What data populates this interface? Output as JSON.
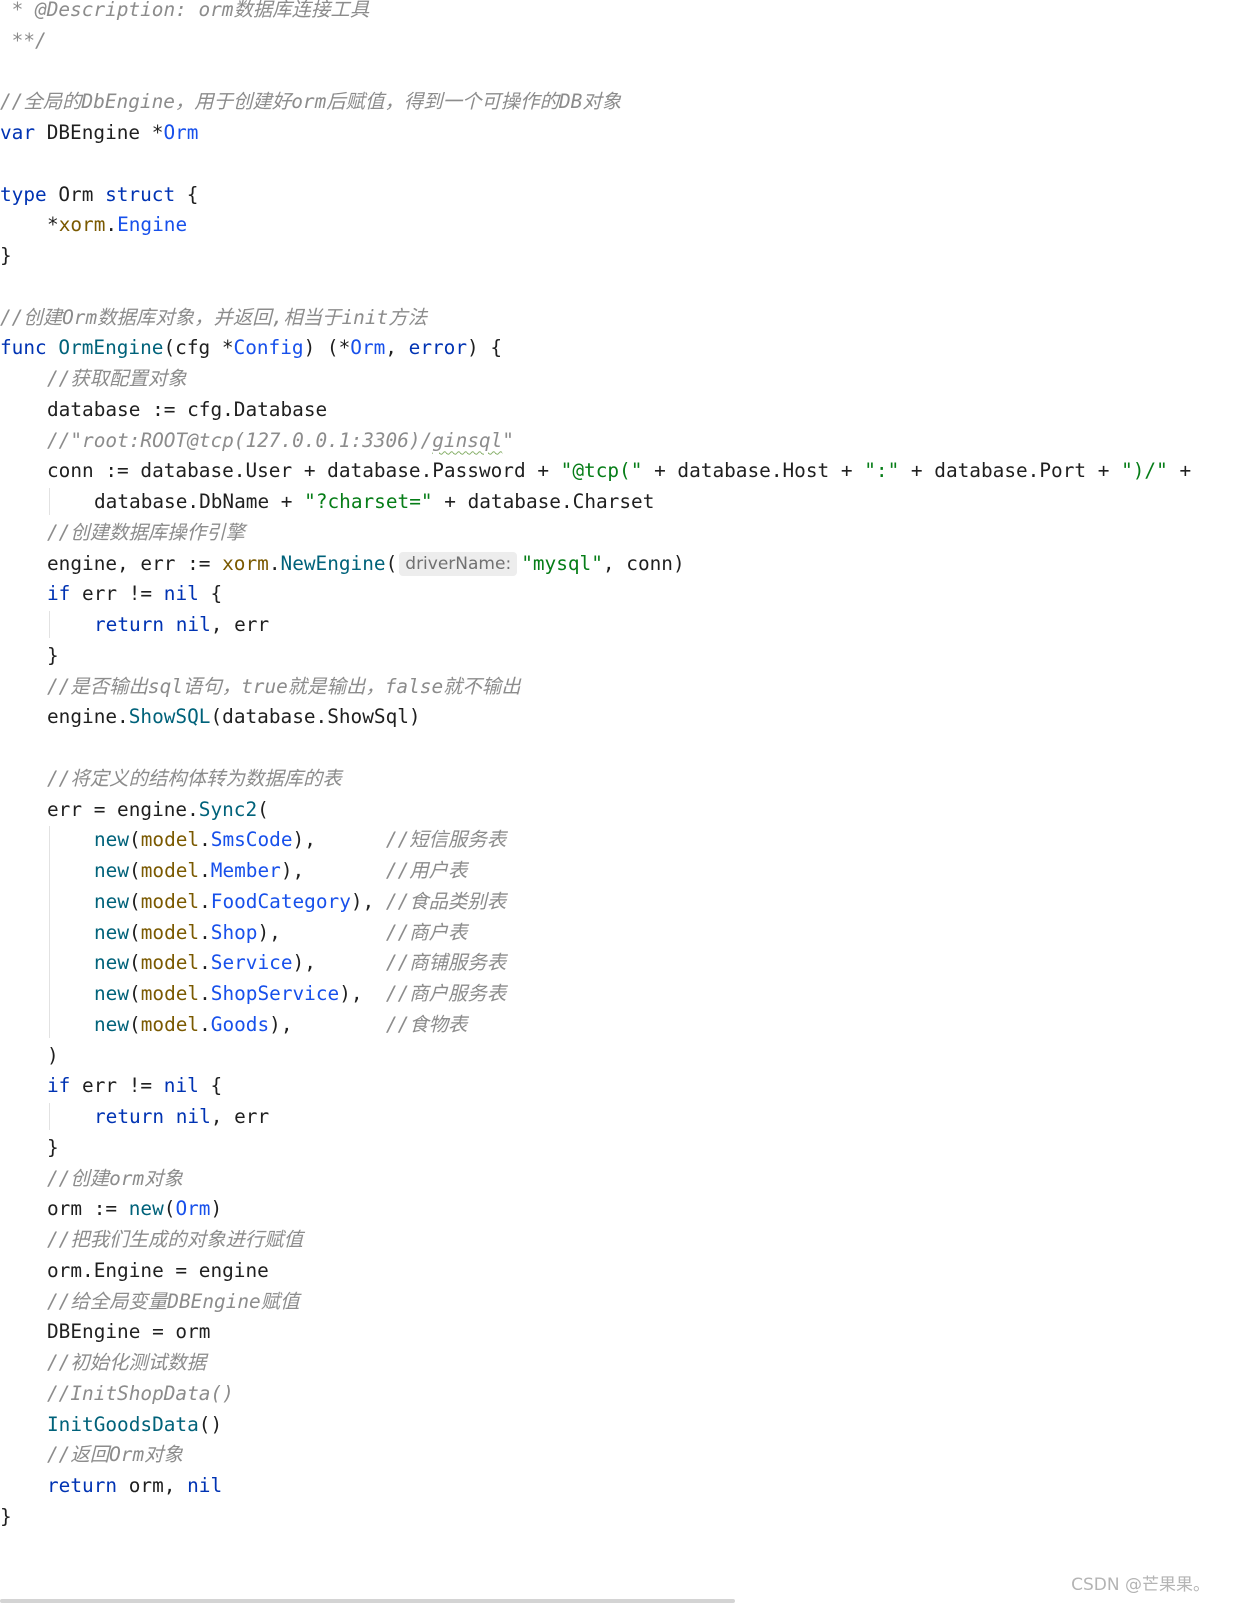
{
  "editor": {
    "lines": [
      {
        "indent": 0,
        "tokens": [
          {
            "t": " * @Description: orm数据库连接工具",
            "c": "comment"
          }
        ]
      },
      {
        "indent": 0,
        "tokens": [
          {
            "t": " **/",
            "c": "comment"
          }
        ]
      },
      {
        "indent": 0,
        "tokens": []
      },
      {
        "indent": 0,
        "tokens": [
          {
            "t": "//全局的DbEngine，用于创建好orm后赋值，得到一个可操作的DB对象",
            "c": "comment"
          }
        ]
      },
      {
        "indent": 0,
        "tokens": [
          {
            "t": "var",
            "c": "kw"
          },
          {
            "t": " DBEngine *",
            "c": "plain"
          },
          {
            "t": "Orm",
            "c": "type"
          }
        ]
      },
      {
        "indent": 0,
        "tokens": []
      },
      {
        "indent": 0,
        "tokens": [
          {
            "t": "type",
            "c": "kw"
          },
          {
            "t": " Orm ",
            "c": "plain"
          },
          {
            "t": "struct",
            "c": "kw"
          },
          {
            "t": " {",
            "c": "plain"
          }
        ]
      },
      {
        "indent": 1,
        "tokens": [
          {
            "t": "*",
            "c": "plain"
          },
          {
            "t": "xorm",
            "c": "pkg"
          },
          {
            "t": ".",
            "c": "plain"
          },
          {
            "t": "Engine",
            "c": "type"
          }
        ]
      },
      {
        "indent": 0,
        "tokens": [
          {
            "t": "}",
            "c": "plain"
          }
        ]
      },
      {
        "indent": 0,
        "tokens": []
      },
      {
        "indent": 0,
        "tokens": [
          {
            "t": "//创建Orm数据库对象，并返回,相当于init方法",
            "c": "comment"
          }
        ]
      },
      {
        "indent": 0,
        "tokens": [
          {
            "t": "func",
            "c": "kw"
          },
          {
            "t": " ",
            "c": "plain"
          },
          {
            "t": "OrmEngine",
            "c": "func"
          },
          {
            "t": "(cfg *",
            "c": "plain"
          },
          {
            "t": "Config",
            "c": "type"
          },
          {
            "t": ") (*",
            "c": "plain"
          },
          {
            "t": "Orm",
            "c": "type"
          },
          {
            "t": ", ",
            "c": "plain"
          },
          {
            "t": "error",
            "c": "kw"
          },
          {
            "t": ") {",
            "c": "plain"
          }
        ]
      },
      {
        "indent": 1,
        "tokens": [
          {
            "t": "//获取配置对象",
            "c": "comment"
          }
        ]
      },
      {
        "indent": 1,
        "tokens": [
          {
            "t": "database := cfg.Database",
            "c": "plain"
          }
        ]
      },
      {
        "indent": 1,
        "tokens": [
          {
            "t": "//\"root:ROOT@tcp(127.0.0.1:3306)/",
            "c": "comment"
          },
          {
            "t": "ginsql",
            "c": "comment",
            "squiggle": true
          },
          {
            "t": "\"",
            "c": "comment"
          }
        ]
      },
      {
        "indent": 1,
        "tokens": [
          {
            "t": "conn := database.User + database.Password + ",
            "c": "plain"
          },
          {
            "t": "\"@tcp(\"",
            "c": "string"
          },
          {
            "t": " + database.Host + ",
            "c": "plain"
          },
          {
            "t": "\":\"",
            "c": "string"
          },
          {
            "t": " + database.Port + ",
            "c": "plain"
          },
          {
            "t": "\")/\"",
            "c": "string"
          },
          {
            "t": " +",
            "c": "plain"
          }
        ]
      },
      {
        "indent": 2,
        "tokens": [
          {
            "t": "database.DbName + ",
            "c": "plain"
          },
          {
            "t": "\"?charset=\"",
            "c": "string"
          },
          {
            "t": " + database.Charset",
            "c": "plain"
          }
        ]
      },
      {
        "indent": 1,
        "tokens": [
          {
            "t": "//创建数据库操作引擎",
            "c": "comment"
          }
        ]
      },
      {
        "indent": 1,
        "tokens": [
          {
            "t": "engine, err := ",
            "c": "plain"
          },
          {
            "t": "xorm",
            "c": "pkg"
          },
          {
            "t": ".",
            "c": "plain"
          },
          {
            "t": "NewEngine",
            "c": "method"
          },
          {
            "t": "(",
            "c": "plain"
          },
          {
            "t": "driverName:",
            "c": "hint"
          },
          {
            "t": "\"mysql\"",
            "c": "string"
          },
          {
            "t": ", conn)",
            "c": "plain"
          }
        ]
      },
      {
        "indent": 1,
        "tokens": [
          {
            "t": "if",
            "c": "kw"
          },
          {
            "t": " err != ",
            "c": "plain"
          },
          {
            "t": "nil",
            "c": "kw"
          },
          {
            "t": " {",
            "c": "plain"
          }
        ]
      },
      {
        "indent": 2,
        "tokens": [
          {
            "t": "return",
            "c": "kw"
          },
          {
            "t": " ",
            "c": "plain"
          },
          {
            "t": "nil",
            "c": "kw"
          },
          {
            "t": ", err",
            "c": "plain"
          }
        ]
      },
      {
        "indent": 1,
        "tokens": [
          {
            "t": "}",
            "c": "plain"
          }
        ]
      },
      {
        "indent": 1,
        "tokens": [
          {
            "t": "//是否输出sql语句，true就是输出，false就不输出",
            "c": "comment"
          }
        ]
      },
      {
        "indent": 1,
        "tokens": [
          {
            "t": "engine.",
            "c": "plain"
          },
          {
            "t": "ShowSQL",
            "c": "method"
          },
          {
            "t": "(database.ShowSql)",
            "c": "plain"
          }
        ]
      },
      {
        "indent": 1,
        "tokens": []
      },
      {
        "indent": 1,
        "tokens": [
          {
            "t": "//将定义的结构体转为数据库的表",
            "c": "comment"
          }
        ]
      },
      {
        "indent": 1,
        "tokens": [
          {
            "t": "err = engine.",
            "c": "plain"
          },
          {
            "t": "Sync2",
            "c": "method"
          },
          {
            "t": "(",
            "c": "plain"
          }
        ]
      },
      {
        "indent": 2,
        "tokens": [
          {
            "t": "new",
            "c": "func"
          },
          {
            "t": "(",
            "c": "plain"
          },
          {
            "t": "model",
            "c": "pkg"
          },
          {
            "t": ".",
            "c": "plain"
          },
          {
            "t": "SmsCode",
            "c": "type"
          },
          {
            "t": "),      ",
            "c": "plain"
          },
          {
            "t": "//短信服务表",
            "c": "comment"
          }
        ]
      },
      {
        "indent": 2,
        "tokens": [
          {
            "t": "new",
            "c": "func"
          },
          {
            "t": "(",
            "c": "plain"
          },
          {
            "t": "model",
            "c": "pkg"
          },
          {
            "t": ".",
            "c": "plain"
          },
          {
            "t": "Member",
            "c": "type"
          },
          {
            "t": "),       ",
            "c": "plain"
          },
          {
            "t": "//用户表",
            "c": "comment"
          }
        ]
      },
      {
        "indent": 2,
        "tokens": [
          {
            "t": "new",
            "c": "func"
          },
          {
            "t": "(",
            "c": "plain"
          },
          {
            "t": "model",
            "c": "pkg"
          },
          {
            "t": ".",
            "c": "plain"
          },
          {
            "t": "FoodCategory",
            "c": "type"
          },
          {
            "t": "), ",
            "c": "plain"
          },
          {
            "t": "//食品类别表",
            "c": "comment"
          }
        ]
      },
      {
        "indent": 2,
        "tokens": [
          {
            "t": "new",
            "c": "func"
          },
          {
            "t": "(",
            "c": "plain"
          },
          {
            "t": "model",
            "c": "pkg"
          },
          {
            "t": ".",
            "c": "plain"
          },
          {
            "t": "Shop",
            "c": "type"
          },
          {
            "t": "),         ",
            "c": "plain"
          },
          {
            "t": "//商户表",
            "c": "comment"
          }
        ]
      },
      {
        "indent": 2,
        "tokens": [
          {
            "t": "new",
            "c": "func"
          },
          {
            "t": "(",
            "c": "plain"
          },
          {
            "t": "model",
            "c": "pkg"
          },
          {
            "t": ".",
            "c": "plain"
          },
          {
            "t": "Service",
            "c": "type"
          },
          {
            "t": "),      ",
            "c": "plain"
          },
          {
            "t": "//商铺服务表",
            "c": "comment"
          }
        ]
      },
      {
        "indent": 2,
        "tokens": [
          {
            "t": "new",
            "c": "func"
          },
          {
            "t": "(",
            "c": "plain"
          },
          {
            "t": "model",
            "c": "pkg"
          },
          {
            "t": ".",
            "c": "plain"
          },
          {
            "t": "ShopService",
            "c": "type"
          },
          {
            "t": "),  ",
            "c": "plain"
          },
          {
            "t": "//商户服务表",
            "c": "comment"
          }
        ]
      },
      {
        "indent": 2,
        "tokens": [
          {
            "t": "new",
            "c": "func"
          },
          {
            "t": "(",
            "c": "plain"
          },
          {
            "t": "model",
            "c": "pkg"
          },
          {
            "t": ".",
            "c": "plain"
          },
          {
            "t": "Goods",
            "c": "type"
          },
          {
            "t": "),        ",
            "c": "plain"
          },
          {
            "t": "//食物表",
            "c": "comment"
          }
        ]
      },
      {
        "indent": 1,
        "tokens": [
          {
            "t": ")",
            "c": "plain"
          }
        ]
      },
      {
        "indent": 1,
        "tokens": [
          {
            "t": "if",
            "c": "kw"
          },
          {
            "t": " err != ",
            "c": "plain"
          },
          {
            "t": "nil",
            "c": "kw"
          },
          {
            "t": " {",
            "c": "plain"
          }
        ]
      },
      {
        "indent": 2,
        "tokens": [
          {
            "t": "return",
            "c": "kw"
          },
          {
            "t": " ",
            "c": "plain"
          },
          {
            "t": "nil",
            "c": "kw"
          },
          {
            "t": ", err",
            "c": "plain"
          }
        ]
      },
      {
        "indent": 1,
        "tokens": [
          {
            "t": "}",
            "c": "plain"
          }
        ]
      },
      {
        "indent": 1,
        "tokens": [
          {
            "t": "//创建orm对象",
            "c": "comment"
          }
        ]
      },
      {
        "indent": 1,
        "tokens": [
          {
            "t": "orm := ",
            "c": "plain"
          },
          {
            "t": "new",
            "c": "func"
          },
          {
            "t": "(",
            "c": "plain"
          },
          {
            "t": "Orm",
            "c": "type"
          },
          {
            "t": ")",
            "c": "plain"
          }
        ]
      },
      {
        "indent": 1,
        "tokens": [
          {
            "t": "//把我们生成的对象进行赋值",
            "c": "comment"
          }
        ]
      },
      {
        "indent": 1,
        "tokens": [
          {
            "t": "orm.Engine = engine",
            "c": "plain"
          }
        ]
      },
      {
        "indent": 1,
        "tokens": [
          {
            "t": "//给全局变量DBEngine赋值",
            "c": "comment"
          }
        ]
      },
      {
        "indent": 1,
        "tokens": [
          {
            "t": "DBEngine = orm",
            "c": "plain"
          }
        ]
      },
      {
        "indent": 1,
        "tokens": [
          {
            "t": "//初始化测试数据",
            "c": "comment"
          }
        ]
      },
      {
        "indent": 1,
        "tokens": [
          {
            "t": "//InitShopData()",
            "c": "comment"
          }
        ]
      },
      {
        "indent": 1,
        "tokens": [
          {
            "t": "InitGoodsData",
            "c": "func"
          },
          {
            "t": "()",
            "c": "plain"
          }
        ]
      },
      {
        "indent": 1,
        "tokens": [
          {
            "t": "//返回Orm对象",
            "c": "comment"
          }
        ]
      },
      {
        "indent": 1,
        "tokens": [
          {
            "t": "return",
            "c": "kw"
          },
          {
            "t": " orm, ",
            "c": "plain"
          },
          {
            "t": "nil",
            "c": "kw"
          }
        ]
      },
      {
        "indent": 0,
        "tokens": [
          {
            "t": "}",
            "c": "plain"
          }
        ]
      }
    ]
  },
  "watermark": "CSDN @芒果果。"
}
